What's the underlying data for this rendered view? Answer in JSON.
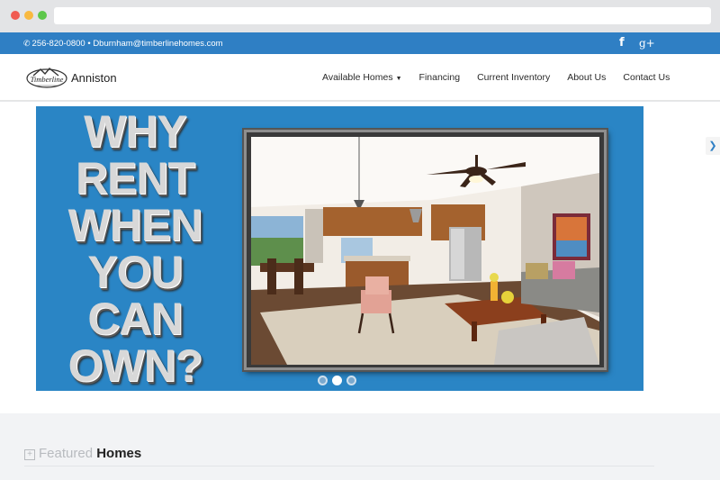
{
  "topbar": {
    "contact_text": "256-820-0800 • Dburnham@timberlinehomes.com",
    "facebook_glyph": "f",
    "googleplus_glyph": "g+"
  },
  "header": {
    "logo_text": "Timberline",
    "brand": "Anniston",
    "nav": [
      "Available Homes",
      "Financing",
      "Current Inventory",
      "About Us",
      "Contact Us"
    ]
  },
  "hero": {
    "lines": [
      "WHY",
      "RENT",
      "WHEN",
      "YOU",
      "CAN",
      "OWN?"
    ],
    "slide_count": 3,
    "active_slide": 2
  },
  "featured": {
    "prefix": "Featured",
    "word": "Homes"
  },
  "colors": {
    "topbar": "#2f7fc4",
    "hero_bg": "#2a85c5"
  }
}
